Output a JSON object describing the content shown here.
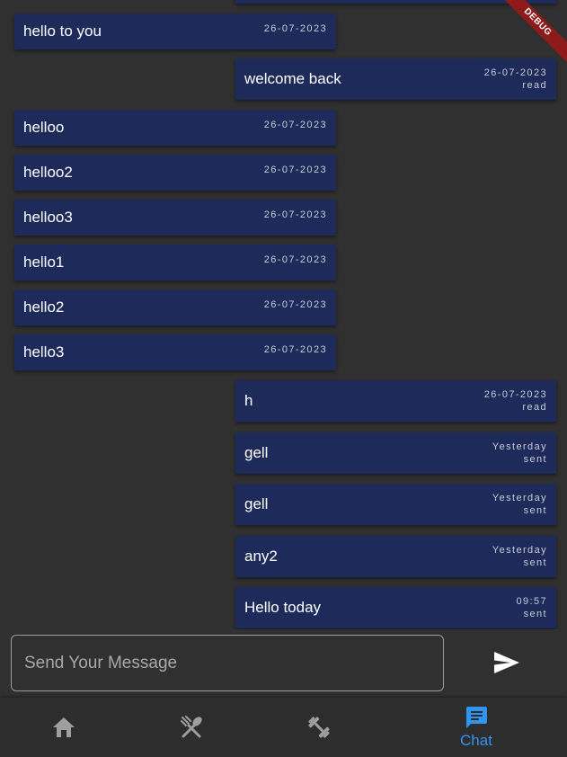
{
  "messages": [
    {
      "direction": "in",
      "text": "hello to you",
      "time": "26-07-2023",
      "status": ""
    },
    {
      "direction": "out",
      "text": "welcome back",
      "time": "26-07-2023",
      "status": "read"
    },
    {
      "direction": "in",
      "text": "helloo",
      "time": "26-07-2023",
      "status": ""
    },
    {
      "direction": "in",
      "text": "helloo2",
      "time": "26-07-2023",
      "status": ""
    },
    {
      "direction": "in",
      "text": "helloo3",
      "time": "26-07-2023",
      "status": ""
    },
    {
      "direction": "in",
      "text": "hello1",
      "time": "26-07-2023",
      "status": ""
    },
    {
      "direction": "in",
      "text": "hello2",
      "time": "26-07-2023",
      "status": ""
    },
    {
      "direction": "in",
      "text": "hello3",
      "time": "26-07-2023",
      "status": ""
    },
    {
      "direction": "out",
      "text": "h",
      "time": "26-07-2023",
      "status": "read"
    },
    {
      "direction": "out",
      "text": "gell",
      "time": "Yesterday",
      "status": "sent"
    },
    {
      "direction": "out",
      "text": "gell",
      "time": "Yesterday",
      "status": "sent"
    },
    {
      "direction": "out",
      "text": "any2",
      "time": "Yesterday",
      "status": "sent"
    },
    {
      "direction": "out",
      "text": "Hello today",
      "time": "09:57",
      "status": "sent"
    }
  ],
  "debug_banner": "DEBUG",
  "composer": {
    "placeholder": "Send Your Message",
    "value": "",
    "send_icon": "send-icon"
  },
  "nav": {
    "items": [
      {
        "icon": "home-icon",
        "label": ""
      },
      {
        "icon": "utensils-icon",
        "label": ""
      },
      {
        "icon": "dumbbell-icon",
        "label": ""
      },
      {
        "icon": "chat-icon",
        "label": "Chat"
      }
    ],
    "active_index": 3
  },
  "colors": {
    "background": "#303030",
    "bubble": "#1d2a5a",
    "nav_background": "#2d2d2d",
    "active": "#2f95f0",
    "inactive_icon": "#9e9e9e"
  }
}
